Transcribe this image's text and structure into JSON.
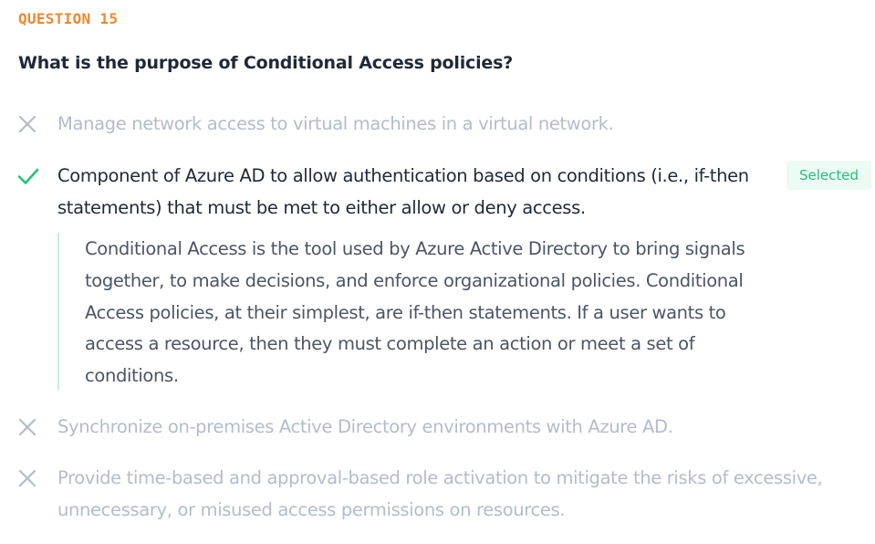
{
  "question": {
    "label": "QUESTION 15",
    "text": "What is the purpose of Conditional Access policies?"
  },
  "options": [
    {
      "text": "Manage network access to virtual machines in a virtual network.",
      "state": "incorrect",
      "icon": "x-icon"
    },
    {
      "text": "Component of Azure AD to allow authentication based on conditions (i.e., if-then statements) that must be met to either allow or deny access.",
      "state": "correct",
      "icon": "checkmark-icon",
      "badge": "Selected",
      "explanation": "Conditional Access is the tool used by Azure Active Directory to bring signals together, to make decisions, and enforce organizational policies. Conditional Access policies, at their simplest, are if-then statements. If a user wants to access a resource, then they must complete an action or meet a set of conditions."
    },
    {
      "text": "Synchronize on-premises Active Directory environments with Azure AD.",
      "state": "incorrect",
      "icon": "x-icon"
    },
    {
      "text": "Provide time-based and approval-based role activation to mitigate the risks of excessive, unnecessary, or misused access permissions on resources.",
      "state": "incorrect",
      "icon": "x-icon"
    }
  ],
  "colors": {
    "label": "#f0882d",
    "correct": "#22c17a",
    "incorrect": "#b3bccb",
    "badge_bg": "#ecfbf3",
    "explanation_border": "#c7eee0"
  }
}
